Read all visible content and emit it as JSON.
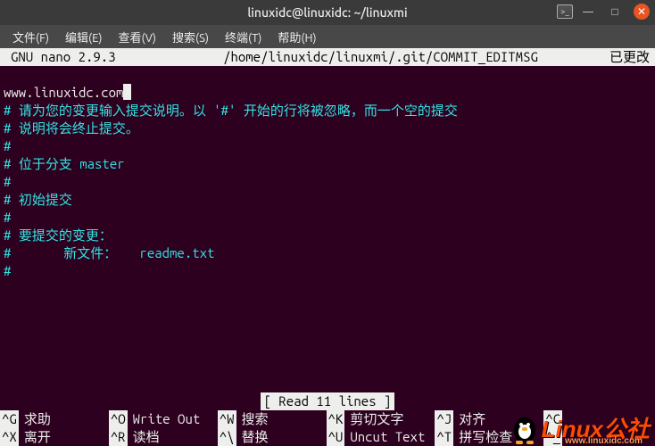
{
  "window": {
    "title": "linuxidc@linuxidc: ~/linuxmi"
  },
  "menubar": {
    "items": [
      "文件(F)",
      "编辑(E)",
      "查看(V)",
      "搜索(S)",
      "终端(T)",
      "帮助(H)"
    ]
  },
  "nano": {
    "app": "GNU nano",
    "version": "2.9.3",
    "filepath": "/home/linuxidc/linuxmi/.git/COMMIT_EDITMSG",
    "modified": "已更改",
    "status": "[ Read 11 lines ]"
  },
  "editor": {
    "input_line": "www.linuxidc.com",
    "comment_lines": [
      "请为您的变更输入提交说明。以 '#' 开始的行将被忽略，而一个空的提交",
      "说明将会终止提交。",
      "",
      "位于分支 master",
      "",
      "初始提交",
      "",
      "要提交的变更："
    ],
    "new_file_label": "新文件：",
    "new_file_name": "readme.txt"
  },
  "hotkeys": {
    "row1": [
      {
        "key": "^G",
        "label": "求助"
      },
      {
        "key": "^O",
        "label": "Write Out"
      },
      {
        "key": "^W",
        "label": "搜索"
      },
      {
        "key": "^K",
        "label": "剪切文字"
      },
      {
        "key": "^J",
        "label": "对齐"
      },
      {
        "key": "^C",
        "label": ""
      }
    ],
    "row2": [
      {
        "key": "^X",
        "label": "离开"
      },
      {
        "key": "^R",
        "label": "读档"
      },
      {
        "key": "^\\",
        "label": "替换"
      },
      {
        "key": "^U",
        "label": "Uncut Text"
      },
      {
        "key": "^T",
        "label": "拼写检查"
      },
      {
        "key": "^_",
        "label": ""
      }
    ]
  },
  "watermark": {
    "text": "Linux公社",
    "url": "www.linuxidc.com"
  }
}
